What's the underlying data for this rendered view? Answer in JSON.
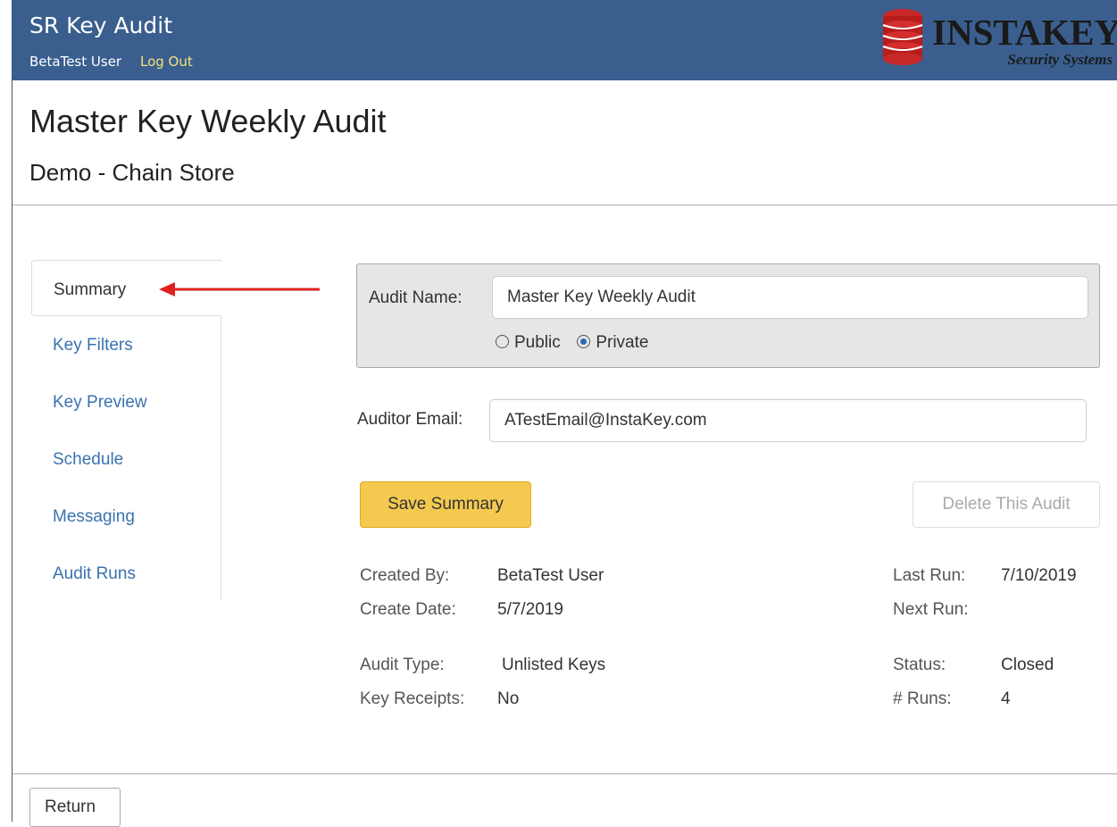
{
  "header": {
    "app_title": "SR Key Audit",
    "user_name": "BetaTest User",
    "logout_label": "Log Out",
    "logo_word": "INSTAKEY",
    "logo_tagline": "Security Systems",
    "bar_color": "#3a5f8f"
  },
  "page": {
    "title": "Master Key Weekly Audit",
    "subtitle": "Demo - Chain Store"
  },
  "tabs": [
    {
      "label": "Summary",
      "active": true
    },
    {
      "label": "Key Filters"
    },
    {
      "label": "Key Preview"
    },
    {
      "label": "Schedule"
    },
    {
      "label": "Messaging"
    },
    {
      "label": "Audit Runs"
    }
  ],
  "form": {
    "audit_name_label": "Audit Name:",
    "audit_name_value": "Master Key Weekly Audit",
    "visibility_options": [
      "Public",
      "Private"
    ],
    "visibility_selected": "Private",
    "auditor_email_label": "Auditor Email:",
    "auditor_email_value": "ATestEmail@InstaKey.com"
  },
  "actions": {
    "save_label": "Save Summary",
    "delete_label": "Delete This Audit",
    "return_label": "Return"
  },
  "details": {
    "created_by_label": "Created By:",
    "created_by": "BetaTest User",
    "create_date_label": "Create Date:",
    "create_date": "5/7/2019",
    "audit_type_label": "Audit Type:",
    "audit_type": "Unlisted Keys",
    "key_receipts_label": "Key Receipts:",
    "key_receipts": "No",
    "last_run_label": "Last Run:",
    "last_run": "7/10/2019",
    "next_run_label": "Next Run:",
    "next_run": "",
    "status_label": "Status:",
    "status": "Closed",
    "runs_label": "# Runs:",
    "runs": "4"
  },
  "annotation": {
    "arrow_color": "#e02020",
    "arrow_target": "Summary tab"
  }
}
